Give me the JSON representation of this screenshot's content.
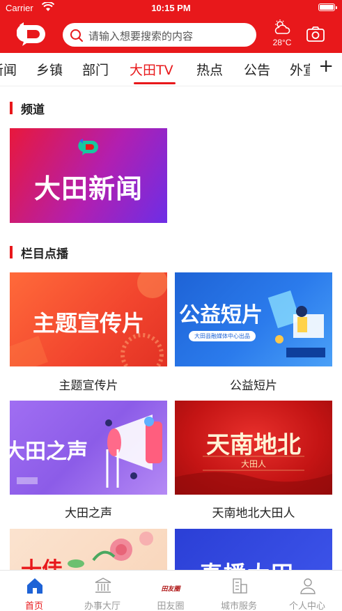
{
  "status": {
    "carrier": "Carrier",
    "time": "10:15 PM"
  },
  "header": {
    "search_placeholder": "请输入想要搜索的内容",
    "temperature": "28°C"
  },
  "tabs": {
    "items": [
      "新闻",
      "乡镇",
      "部门",
      "大田TV",
      "热点",
      "公告",
      "外宣"
    ],
    "active_index": 3
  },
  "channel_section": {
    "title": "频道",
    "banner_text": "大田新闻"
  },
  "program_section": {
    "title": "栏目点播",
    "items": [
      {
        "title": "主题宣传片",
        "banner_text": "主题宣传片"
      },
      {
        "title": "公益短片",
        "banner_text": "公益短片",
        "banner_sub": "大田县融媒体中心出品"
      },
      {
        "title": "大田之声",
        "banner_text": "大田之声"
      },
      {
        "title": "天南地北大田人",
        "banner_text": "天南地北",
        "banner_sub": "大田人"
      },
      {
        "title": "",
        "banner_text": "十佳"
      },
      {
        "title": "",
        "banner_text": "直播大田"
      }
    ]
  },
  "bottom_nav": {
    "items": [
      "首页",
      "办事大厅",
      "田友圈",
      "城市服务",
      "个人中心"
    ],
    "active_index": 0,
    "tianyou_badge": "田友圈"
  },
  "colors": {
    "brand_red": "#e8181b"
  }
}
